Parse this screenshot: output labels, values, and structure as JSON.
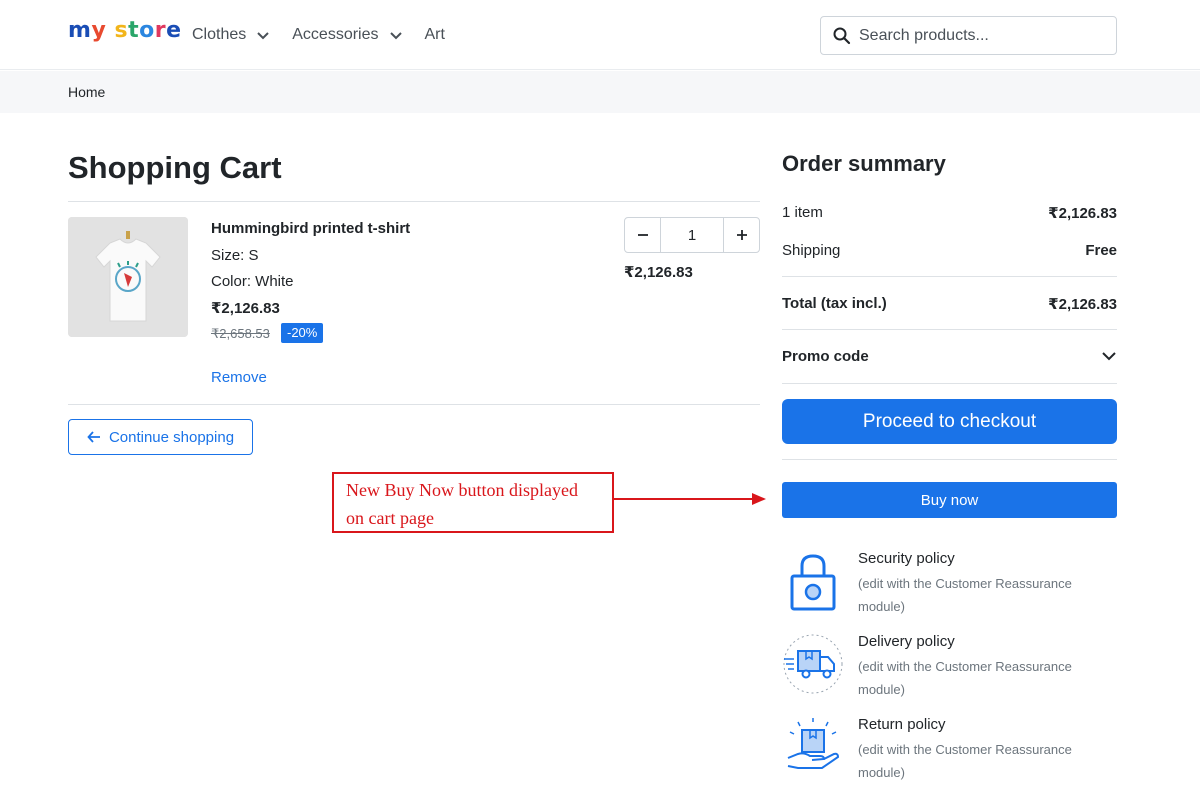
{
  "header": {
    "logo": [
      "m",
      "y",
      " ",
      "s",
      "t",
      "o",
      "r",
      "e"
    ],
    "nav": [
      {
        "label": "Clothes",
        "has_dropdown": true
      },
      {
        "label": "Accessories",
        "has_dropdown": true
      },
      {
        "label": "Art",
        "has_dropdown": false
      }
    ],
    "search_placeholder": "Search products..."
  },
  "breadcrumb": {
    "items": [
      "Home"
    ]
  },
  "cart": {
    "title": "Shopping Cart",
    "item": {
      "name": "Hummingbird printed t-shirt",
      "size": "Size: S",
      "color": "Color: White",
      "price": "₹2,126.83",
      "old_price": "₹2,658.53",
      "discount": "-20%",
      "remove_label": "Remove",
      "quantity": "1",
      "line_total": "₹2,126.83"
    },
    "continue_label": "Continue shopping"
  },
  "summary": {
    "title": "Order summary",
    "items_label": "1 item",
    "items_value": "₹2,126.83",
    "shipping_label": "Shipping",
    "shipping_value": "Free",
    "total_label": "Total (tax incl.)",
    "total_value": "₹2,126.83",
    "promo_label": "Promo code",
    "checkout_label": "Proceed to checkout",
    "buynow_label": "Buy now"
  },
  "reassurance": [
    {
      "title": "Security policy",
      "desc": "(edit with the Customer Reassurance module)",
      "icon": "lock-icon"
    },
    {
      "title": "Delivery policy",
      "desc": "(edit with the Customer Reassurance module)",
      "icon": "delivery-truck-icon"
    },
    {
      "title": "Return policy",
      "desc": "(edit with the Customer Reassurance module)",
      "icon": "return-package-icon"
    }
  ],
  "annotation": {
    "line1": "New Buy Now button displayed",
    "line2": "on cart page"
  },
  "colors": {
    "primary": "#1a73e8",
    "annotation": "#d9161b"
  }
}
